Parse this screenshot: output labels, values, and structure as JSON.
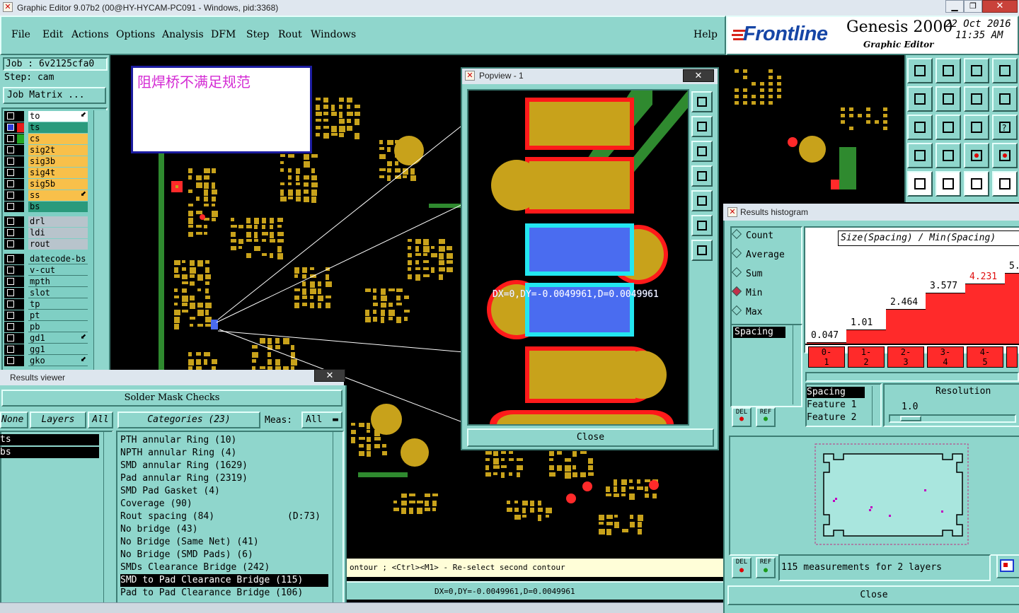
{
  "app": {
    "title_bar": "Graphic Editor 9.07b2 (00@HY-HYCAM-PC091 - Windows, pid:3368)",
    "brand": "Frontline",
    "product": "Genesis 2000",
    "subtitle": "Graphic Editor",
    "date": "22 Oct 2016",
    "time": "11:35 AM"
  },
  "menu": [
    "File",
    "Edit",
    "Actions",
    "Options",
    "Analysis",
    "DFM",
    "Step",
    "Rout",
    "Windows"
  ],
  "help_label": "Help",
  "job": {
    "job_line": "Job : 6v2125cfa0",
    "step_line": "Step: cam",
    "matrix_button": "Job Matrix ..."
  },
  "layers": [
    "to",
    "ts",
    "cs",
    "sig2t",
    "sig3b",
    "sig4t",
    "sig5b",
    "ss",
    "bs",
    "drl",
    "ldi",
    "rout",
    "datecode-bs",
    "v-cut",
    "mpth",
    "slot",
    "tp",
    "pt",
    "pb",
    "gd1",
    "gg1",
    "gko"
  ],
  "annotation": "阻焊桥不满足规范",
  "popview": {
    "title": "Popview - 1",
    "measure_text": "DX=0,DY=-0.0049961,D=0.0049961",
    "close": "Close"
  },
  "results_viewer": {
    "title": "Results viewer",
    "heading": "Solder Mask Checks",
    "none_btn": "None",
    "layers_btn": "Layers",
    "all_btn": "All",
    "categories_label": "Categories (23)",
    "meas_label": "Meas:",
    "meas_value": "All",
    "layer_items": [
      "ts",
      "bs"
    ],
    "categories": [
      {
        "name": "PTH annular Ring (10)",
        "extra": ""
      },
      {
        "name": "NPTH annular Ring (4)",
        "extra": ""
      },
      {
        "name": "SMD annular Ring (1629)",
        "extra": ""
      },
      {
        "name": "Pad annular Ring (2319)",
        "extra": ""
      },
      {
        "name": "SMD Pad Gasket (4)",
        "extra": ""
      },
      {
        "name": "Coverage (90)",
        "extra": ""
      },
      {
        "name": "Rout spacing (84)",
        "extra": "(D:73)"
      },
      {
        "name": "No bridge (43)",
        "extra": ""
      },
      {
        "name": "No Bridge (Same Net) (41)",
        "extra": ""
      },
      {
        "name": "No Bridge (SMD Pads) (6)",
        "extra": ""
      },
      {
        "name": "SMDs Clearance Bridge (242)",
        "extra": ""
      },
      {
        "name": "SMD to Pad Clearance Bridge (115)",
        "extra": ""
      },
      {
        "name": "Pad to Pad Clearance Bridge (106)",
        "extra": ""
      }
    ],
    "selected_index": 11
  },
  "status": {
    "prompt": "ontour ; <Ctrl><M1> - Re-select second contour",
    "measure": "DX=0,DY=-0.0049961,D=0.0049961"
  },
  "histogram": {
    "title": "Results histogram",
    "modes": [
      "Count",
      "Average",
      "Sum",
      "Min",
      "Max"
    ],
    "selected_mode": "Min",
    "chart_title": "Size(Spacing) / Min(Spacing)",
    "list_item": "Spacing",
    "bars": [
      {
        "range": "0-\n1",
        "value": "0.047",
        "height": 0.047
      },
      {
        "range": "1-\n2",
        "value": "1.01",
        "height": 1.01
      },
      {
        "range": "2-\n3",
        "value": "2.464",
        "height": 2.464
      },
      {
        "range": "3-\n4",
        "value": "3.577",
        "height": 3.577
      },
      {
        "range": "4-\n5",
        "value": "4.231",
        "height": 4.231
      },
      {
        "range": "",
        "value": "5.",
        "height": 5.0
      }
    ],
    "highlight_value": "4.231",
    "fields": [
      "Spacing",
      "Feature 1",
      "Feature 2"
    ],
    "resolution_label": "Resolution",
    "resolution_value": "1.0",
    "del_label": "DEL",
    "ref_label": "REF",
    "summary": "115 measurements for 2 layers",
    "close": "Close"
  },
  "colors": {
    "panel": "#8fd6cc",
    "copper": "#c8a21b",
    "trace": "#2f8a2f",
    "mask": "#ff1a1a",
    "selected": "#4a6cf0",
    "highlight": "#23e6f0"
  }
}
